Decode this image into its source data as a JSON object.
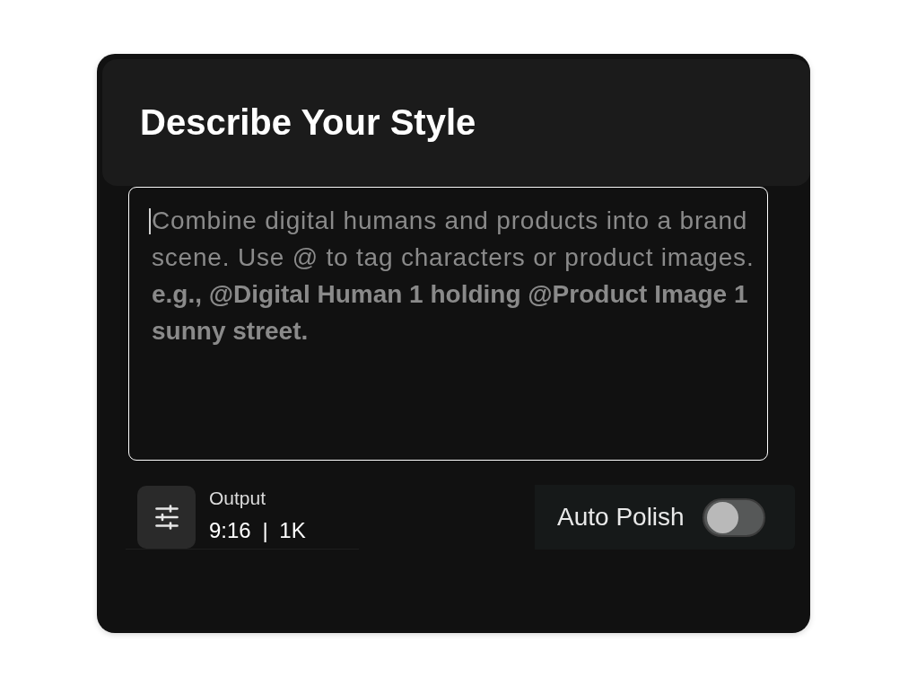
{
  "header": {
    "title": "Describe Your Style"
  },
  "prompt": {
    "focused": true,
    "placeholder": "Combine digital humans and products into a brand\nscene. Use @ to tag characters or product images.\n**e.g., @Digital Human 1 holding @Product Image 1**\n**sunny street.**"
  },
  "output": {
    "label": "Output",
    "value": "9:16 | 1K"
  },
  "auto_polish": {
    "label": "Auto Polish",
    "on": false
  }
}
